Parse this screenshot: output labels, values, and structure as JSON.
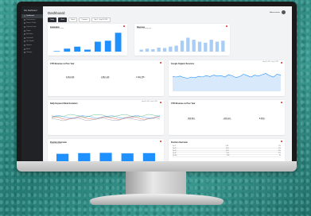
{
  "app": {
    "brand": "Site Dashboard",
    "page_title": "Dashboard",
    "user_name": "Administrator"
  },
  "sidebar": {
    "items": [
      {
        "label": "Dashboard",
        "icon": "grid-icon",
        "active": true
      },
      {
        "label": "Performance",
        "icon": "chart-icon",
        "active": false
      },
      {
        "label": "Search Traffic",
        "icon": "search-icon",
        "active": false
      },
      {
        "label": "Content Index",
        "icon": "document-icon",
        "active": false
      },
      {
        "label": "Pages",
        "icon": "page-icon",
        "active": false
      },
      {
        "label": "Backlinks",
        "icon": "link-icon",
        "active": false
      },
      {
        "label": "Keywords",
        "icon": "key-icon",
        "active": false
      },
      {
        "label": "Site Health",
        "icon": "heart-icon",
        "active": false
      },
      {
        "label": "Reports",
        "icon": "report-icon",
        "active": false
      },
      {
        "label": "Alerts",
        "icon": "bell-icon",
        "active": false
      },
      {
        "label": "Settings",
        "icon": "gear-icon",
        "active": false
      }
    ]
  },
  "filters": [
    {
      "label": "Today",
      "dark": true
    },
    {
      "label": "Week",
      "dark": true
    },
    {
      "label": "Month",
      "dark": false
    },
    {
      "label": "Compare",
      "dark": false
    },
    {
      "label": "Sep 1 - Sep 30, 2021",
      "dark": false
    }
  ],
  "cards": {
    "indexation": {
      "title": "Indexation",
      "subtitle": "Indexed pages by status",
      "bars": [
        0.0,
        0.15,
        0.25,
        0.1,
        0.5,
        0.55,
        0.95
      ]
    },
    "revenue": {
      "title": "Revenue",
      "subtitle": "Sessions by landing page",
      "bars": [
        0.1,
        0.15,
        0.12,
        0.2,
        0.18,
        0.25,
        0.3,
        0.55,
        0.7,
        0.6,
        0.5,
        0.45,
        0.6,
        0.5,
        0.55
      ]
    },
    "ctr": {
      "title": "CTR Revenue vs Prev Year",
      "kpis": [
        {
          "value": "2,084,346",
          "change": "",
          "label": "Current Period"
        },
        {
          "value": "1,862,126",
          "change": "",
          "label": "Previous period"
        },
        {
          "value": "1,284,768",
          "change": "↑",
          "label": "Change"
        }
      ]
    },
    "organic": {
      "title": "Google Organic Sessions",
      "range": "Aug 29, 2021 - Sep 4, 2021",
      "series": [
        0.62,
        0.6,
        0.64,
        0.58,
        0.55,
        0.6,
        0.57,
        0.63,
        0.6,
        0.66,
        0.62,
        0.68,
        0.64,
        0.66,
        0.6,
        0.7,
        0.65,
        0.58,
        0.62,
        0.72,
        0.66,
        0.6,
        0.68,
        0.64,
        0.7,
        0.75,
        0.66,
        0.6,
        0.72,
        0.68
      ]
    },
    "daily": {
      "title": "Daily Keyword Rank Evolution",
      "range": "Aug 29, 2021 - Sep 4, 2021",
      "legend": [
        "Top 3",
        "Top 10",
        "Top 20",
        "Top 100"
      ]
    },
    "ctr2": {
      "title": "CTR Revenue vs Prev Year",
      "kpis": [
        {
          "value": "452,816",
          "change": "",
          "label": "Current Period"
        },
        {
          "value": "226,321",
          "change": "",
          "label": "Previous period"
        },
        {
          "value": "8.45%",
          "change": "↑",
          "label": "Change"
        }
      ]
    },
    "position": {
      "title": "Position Overview",
      "subtitle": "Keyword distribution",
      "bars": [
        0.55,
        0.6,
        0.62,
        0.58,
        0.6
      ]
    },
    "position_table": {
      "title": "Position Overview",
      "rows": [
        [
          "Top 3",
          "2,345",
          "12%"
        ],
        [
          "Top 10",
          "4,201",
          "21%"
        ],
        [
          "Top 20",
          "5,812",
          "18%"
        ],
        [
          "Top 50",
          "7,104",
          "15%"
        ],
        [
          "Top 100",
          "9,330",
          "9%"
        ]
      ]
    }
  },
  "colors": {
    "accent": "#1e90ff",
    "sidebar": "#202226",
    "alert": "#e0443a"
  }
}
